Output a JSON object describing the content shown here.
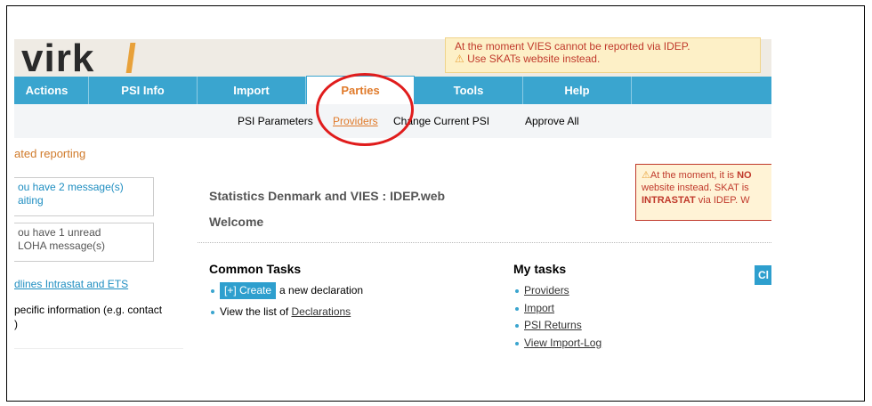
{
  "header": {
    "logo_text": "virk",
    "alert_top": {
      "line1": "At the moment VIES cannot be reported via IDEP.",
      "line2": "Use SKATs website instead."
    }
  },
  "nav": {
    "items": [
      {
        "label": "Actions"
      },
      {
        "label": "PSI Info"
      },
      {
        "label": "Import"
      },
      {
        "label": "Parties"
      },
      {
        "label": "Tools"
      },
      {
        "label": "Help"
      }
    ]
  },
  "subnav": {
    "psi_parameters": "PSI Parameters",
    "providers": "Providers",
    "change_psi": "Change Current PSI",
    "approve_all": "Approve All"
  },
  "left": {
    "title": "ated reporting",
    "msg1_line1": "ou have 2 message(s)",
    "msg1_line2": "aiting",
    "msg2_line1": "ou have 1 unread",
    "msg2_line2": "LOHA message(s)",
    "link": "dlines Intrastat and ETS",
    "text_line1": "pecific information (e.g. contact",
    "text_line2": ")"
  },
  "alert_right": {
    "pre": "At the moment, it is ",
    "bold": "NO",
    "line2": "website instead. SKAT is",
    "line3_bold": "INTRASTAT",
    "line3_rest": " via IDEP. W"
  },
  "main": {
    "title": "Statistics Denmark and VIES : IDEP.web",
    "welcome": "Welcome",
    "common_tasks": {
      "title": "Common Tasks",
      "create_btn": "[+] Create",
      "create_rest": "a new declaration",
      "view_pre": "View the list of ",
      "view_link": "Declarations"
    },
    "my_tasks": {
      "title": "My tasks",
      "items": [
        "Providers",
        "Import",
        "PSI Returns",
        "View Import-Log"
      ]
    },
    "cl_button": "Cl"
  },
  "colors": {
    "nav_blue": "#3aa5cf",
    "accent_orange": "#e07a2a",
    "alert_red": "#c0392b",
    "callout_red": "#e01c1c"
  }
}
